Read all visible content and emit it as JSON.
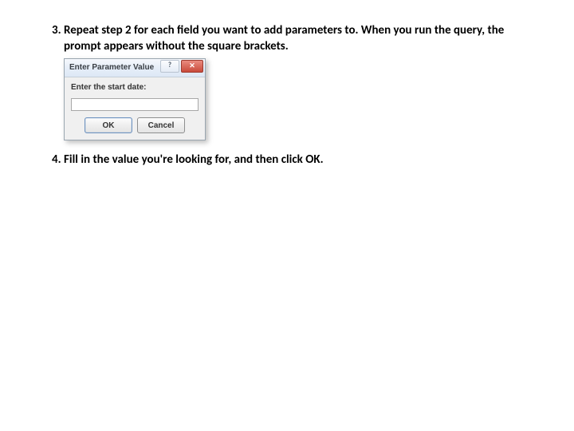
{
  "steps": {
    "s3": {
      "number": "3.",
      "text": "Repeat step 2 for each field you want to add parameters to. When you run the query, the prompt appears without the square brackets."
    },
    "s4": {
      "number": "4.",
      "text_a": "Fill in the value you're looking for, and then click ",
      "text_b": "OK",
      "text_c": "."
    }
  },
  "dialog": {
    "title": "Enter Parameter Value",
    "prompt": "Enter the start date:",
    "input_value": "",
    "ok": "OK",
    "cancel": "Cancel",
    "help_glyph": "?",
    "close_glyph": "✕"
  }
}
